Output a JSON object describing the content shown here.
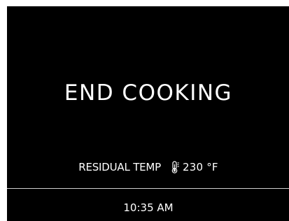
{
  "screen": {
    "title": "END COOKING",
    "residual": {
      "label": "RESIDUAL TEMP",
      "value": "230 °F",
      "icon": "thermometer-icon"
    },
    "time": "10:35 AM"
  },
  "colors": {
    "background": "#000000",
    "text": "#ffffff",
    "divider": "#cfcfcf"
  }
}
